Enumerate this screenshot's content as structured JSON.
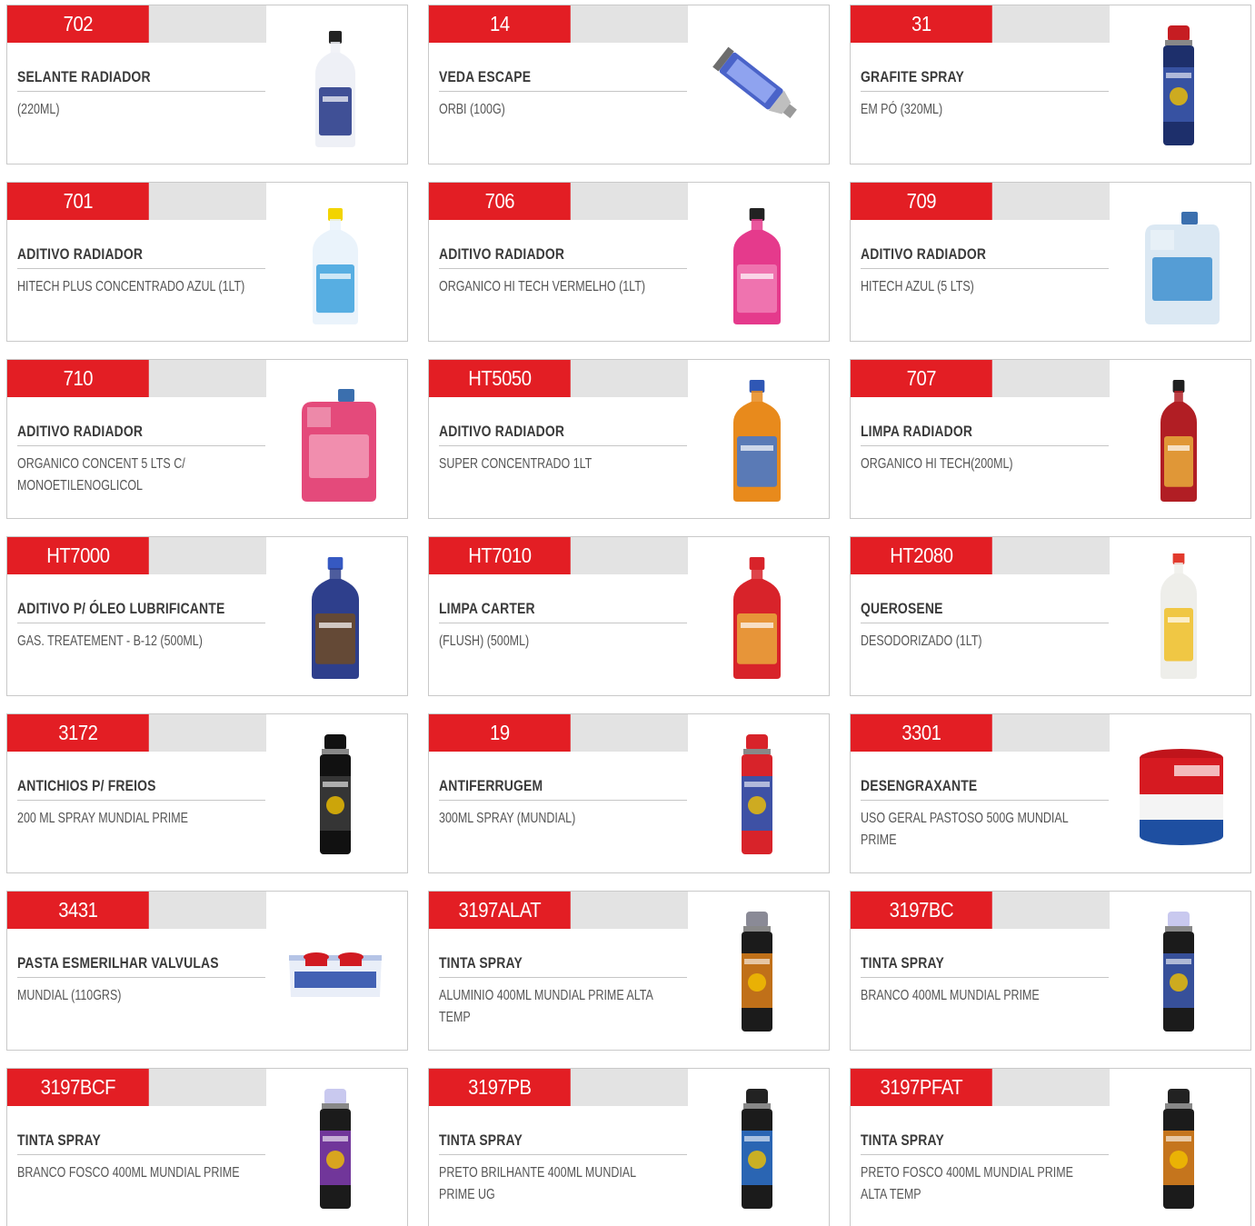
{
  "products": [
    {
      "code": "702",
      "name": "SELANTE RADIADOR",
      "desc": "(220ML)",
      "icon": "radiator-sealant-bottle-icon"
    },
    {
      "code": "14",
      "name": "VEDA ESCAPE",
      "desc": "ORBI (100G)",
      "icon": "exhaust-sealant-tube-icon"
    },
    {
      "code": "31",
      "name": "GRAFITE SPRAY",
      "desc": "EM PÓ (320ML)",
      "icon": "graphite-spray-can-icon"
    },
    {
      "code": "701",
      "name": "ADITIVO RADIADOR",
      "desc": "HITECH PLUS CONCENTRADO AZUL (1LT)",
      "icon": "blue-coolant-bottle-icon"
    },
    {
      "code": "706",
      "name": "ADITIVO RADIADOR",
      "desc": "ORGANICO HI TECH VERMELHO (1LT)",
      "icon": "pink-coolant-bottle-icon"
    },
    {
      "code": "709",
      "name": "ADITIVO RADIADOR",
      "desc": "HITECH AZUL (5 LTS)",
      "icon": "blue-coolant-jug-icon"
    },
    {
      "code": "710",
      "name": "ADITIVO RADIADOR",
      "desc": "ORGANICO CONCENT 5 LTS C/ MONOETILENOGLICOL",
      "icon": "pink-coolant-jug-icon"
    },
    {
      "code": "HT5050",
      "name": "ADITIVO RADIADOR",
      "desc": "SUPER CONCENTRADO 1LT",
      "icon": "orange-additive-bottle-icon"
    },
    {
      "code": "707",
      "name": "LIMPA RADIADOR",
      "desc": "ORGANICO HI TECH(200ML)",
      "icon": "red-cleaner-bottle-icon"
    },
    {
      "code": "HT7000",
      "name": "ADITIVO P/ ÓLEO LUBRIFICANTE",
      "desc": "GAS. TREATEMENT - B-12 (500ML)",
      "icon": "oil-additive-bottle-icon"
    },
    {
      "code": "HT7010",
      "name": "LIMPA CARTER",
      "desc": "(FLUSH) (500ML)",
      "icon": "flush-bottle-icon"
    },
    {
      "code": "HT2080",
      "name": "QUEROSENE",
      "desc": "DESODORIZADO (1LT)",
      "icon": "kerosene-bottle-icon"
    },
    {
      "code": "3172",
      "name": "ANTICHIOS P/ FREIOS",
      "desc": "200 ML SPRAY MUNDIAL PRIME",
      "icon": "black-spray-can-icon"
    },
    {
      "code": "19",
      "name": "ANTIFERRUGEM",
      "desc": "300ML SPRAY (MUNDIAL)",
      "icon": "red-spray-can-icon"
    },
    {
      "code": "3301",
      "name": "DESENGRAXANTE",
      "desc": "USO GERAL PASTOSO 500G MUNDIAL PRIME",
      "icon": "degreaser-tub-icon"
    },
    {
      "code": "3431",
      "name": "PASTA ESMERILHAR VALVULAS",
      "desc": "MUNDIAL (110GRS)",
      "icon": "valve-paste-box-icon"
    },
    {
      "code": "3197ALAT",
      "name": "TINTA SPRAY",
      "desc": "ALUMINIO 400ML MUNDIAL PRIME ALTA TEMP",
      "icon": "aluminium-paint-spray-icon"
    },
    {
      "code": "3197BC",
      "name": "TINTA SPRAY",
      "desc": "BRANCO 400ML MUNDIAL PRIME",
      "icon": "white-paint-spray-icon"
    },
    {
      "code": "3197BCF",
      "name": "TINTA SPRAY",
      "desc": "BRANCO FOSCO 400ML MUNDIAL PRIME",
      "icon": "matte-white-paint-spray-icon"
    },
    {
      "code": "3197PB",
      "name": "TINTA SPRAY",
      "desc": "PRETO BRILHANTE 400ML MUNDIAL PRIME UG",
      "icon": "gloss-black-paint-spray-icon"
    },
    {
      "code": "3197PFAT",
      "name": "TINTA SPRAY",
      "desc": "PRETO FOSCO 400ML MUNDIAL PRIME ALTA TEMP",
      "icon": "matte-black-paint-spray-icon"
    }
  ],
  "colors": {
    "badge": "#e31e24",
    "bar": "#e3e3e3",
    "border": "#c9c9c9"
  }
}
